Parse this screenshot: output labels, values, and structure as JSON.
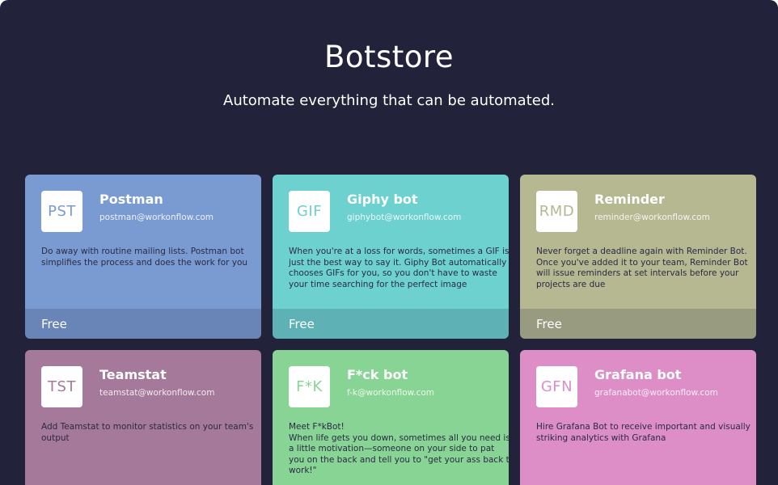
{
  "header": {
    "title": "Botstore",
    "subtitle": "Automate everything that can be automated."
  },
  "bots": [
    {
      "icon_text": "PST",
      "name": "Postman",
      "email": "postman@workonflow.com",
      "description_lines": [
        "Do away with routine mailing lists. Postman bot",
        "simplifies the process and does the work for you"
      ],
      "price": "Free",
      "color": "#7a9bd2"
    },
    {
      "icon_text": "GIF",
      "name": "Giphy bot",
      "email": "giphybot@workonflow.com",
      "description_lines": [
        "When you're at a loss for words, sometimes a GIF is",
        "just the best way to say it. Giphy Bot automatically",
        "chooses GIFs for you, so you don't have to waste",
        "your time searching for the perfect image"
      ],
      "price": "Free",
      "color": "#6dd2cf"
    },
    {
      "icon_text": "RMD",
      "name": "Reminder",
      "email": "reminder@workonflow.com",
      "description_lines": [
        "Never forget a deadline again with Reminder Bot.",
        "Once you've added it to your team, Reminder Bot",
        "will issue reminders at set intervals before your",
        "projects are due"
      ],
      "price": "Free",
      "color": "#b5b891"
    },
    {
      "icon_text": "TST",
      "name": "Teamstat",
      "email": "teamstat@workonflow.com",
      "description_lines": [
        "Add Teamstat to monitor statistics on your team's",
        "output"
      ],
      "color": "#a5799a"
    },
    {
      "icon_text": "F*K",
      "name": "F*ck bot",
      "email": "f-k@workonflow.com",
      "description_lines": [
        "Meet F*kBot!",
        "When life gets you down, sometimes all you need is",
        "a little motivation—someone on your side to pat",
        "you on the back and tell you to \"get your ass back to",
        "work!\""
      ],
      "color": "#88d494"
    },
    {
      "icon_text": "GFN",
      "name": "Grafana bot",
      "email": "grafanabot@workonflow.com",
      "description_lines": [
        "Hire Grafana Bot to receive important and visually",
        "striking analytics with Grafana"
      ],
      "color": "#dd8ec6"
    }
  ]
}
